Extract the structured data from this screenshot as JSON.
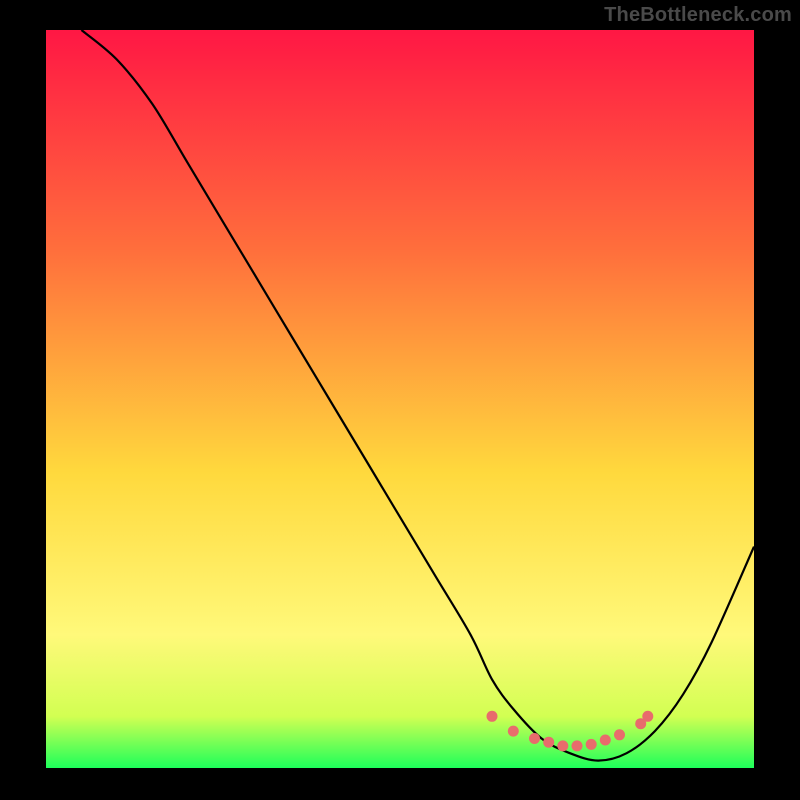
{
  "watermark": "TheBottleneck.com",
  "colors": {
    "frame_bg": "#000000",
    "gradient_top": "#ff1744",
    "gradient_mid1": "#ff6f3c",
    "gradient_mid2": "#ffd93d",
    "gradient_low": "#fff97a",
    "gradient_green": "#1dff5a",
    "curve_stroke": "#000000",
    "marker_fill": "#e86c6c"
  },
  "chart_data": {
    "type": "line",
    "title": "",
    "xlabel": "",
    "ylabel": "",
    "xlim": [
      0,
      100
    ],
    "ylim": [
      0,
      100
    ],
    "series": [
      {
        "name": "bottleneck-curve",
        "x": [
          5,
          10,
          15,
          20,
          25,
          30,
          35,
          40,
          45,
          50,
          55,
          60,
          63,
          66,
          70,
          74,
          78,
          82,
          86,
          90,
          94,
          100
        ],
        "y": [
          100,
          96,
          90,
          82,
          74,
          66,
          58,
          50,
          42,
          34,
          26,
          18,
          12,
          8,
          4,
          2,
          1,
          2,
          5,
          10,
          17,
          30
        ]
      }
    ],
    "markers": {
      "name": "optimal-range-markers",
      "color": "#e86c6c",
      "points": [
        {
          "x": 63,
          "y": 7
        },
        {
          "x": 66,
          "y": 5
        },
        {
          "x": 69,
          "y": 4
        },
        {
          "x": 71,
          "y": 3.5
        },
        {
          "x": 73,
          "y": 3
        },
        {
          "x": 75,
          "y": 3
        },
        {
          "x": 77,
          "y": 3.2
        },
        {
          "x": 79,
          "y": 3.8
        },
        {
          "x": 81,
          "y": 4.5
        },
        {
          "x": 84,
          "y": 6
        },
        {
          "x": 85,
          "y": 7
        }
      ]
    },
    "gradient_stops": [
      {
        "offset": 0.0,
        "color": "#ff1744"
      },
      {
        "offset": 0.3,
        "color": "#ff6f3c"
      },
      {
        "offset": 0.6,
        "color": "#ffd93d"
      },
      {
        "offset": 0.82,
        "color": "#fff97a"
      },
      {
        "offset": 0.93,
        "color": "#d2ff52"
      },
      {
        "offset": 1.0,
        "color": "#1dff5a"
      }
    ]
  }
}
